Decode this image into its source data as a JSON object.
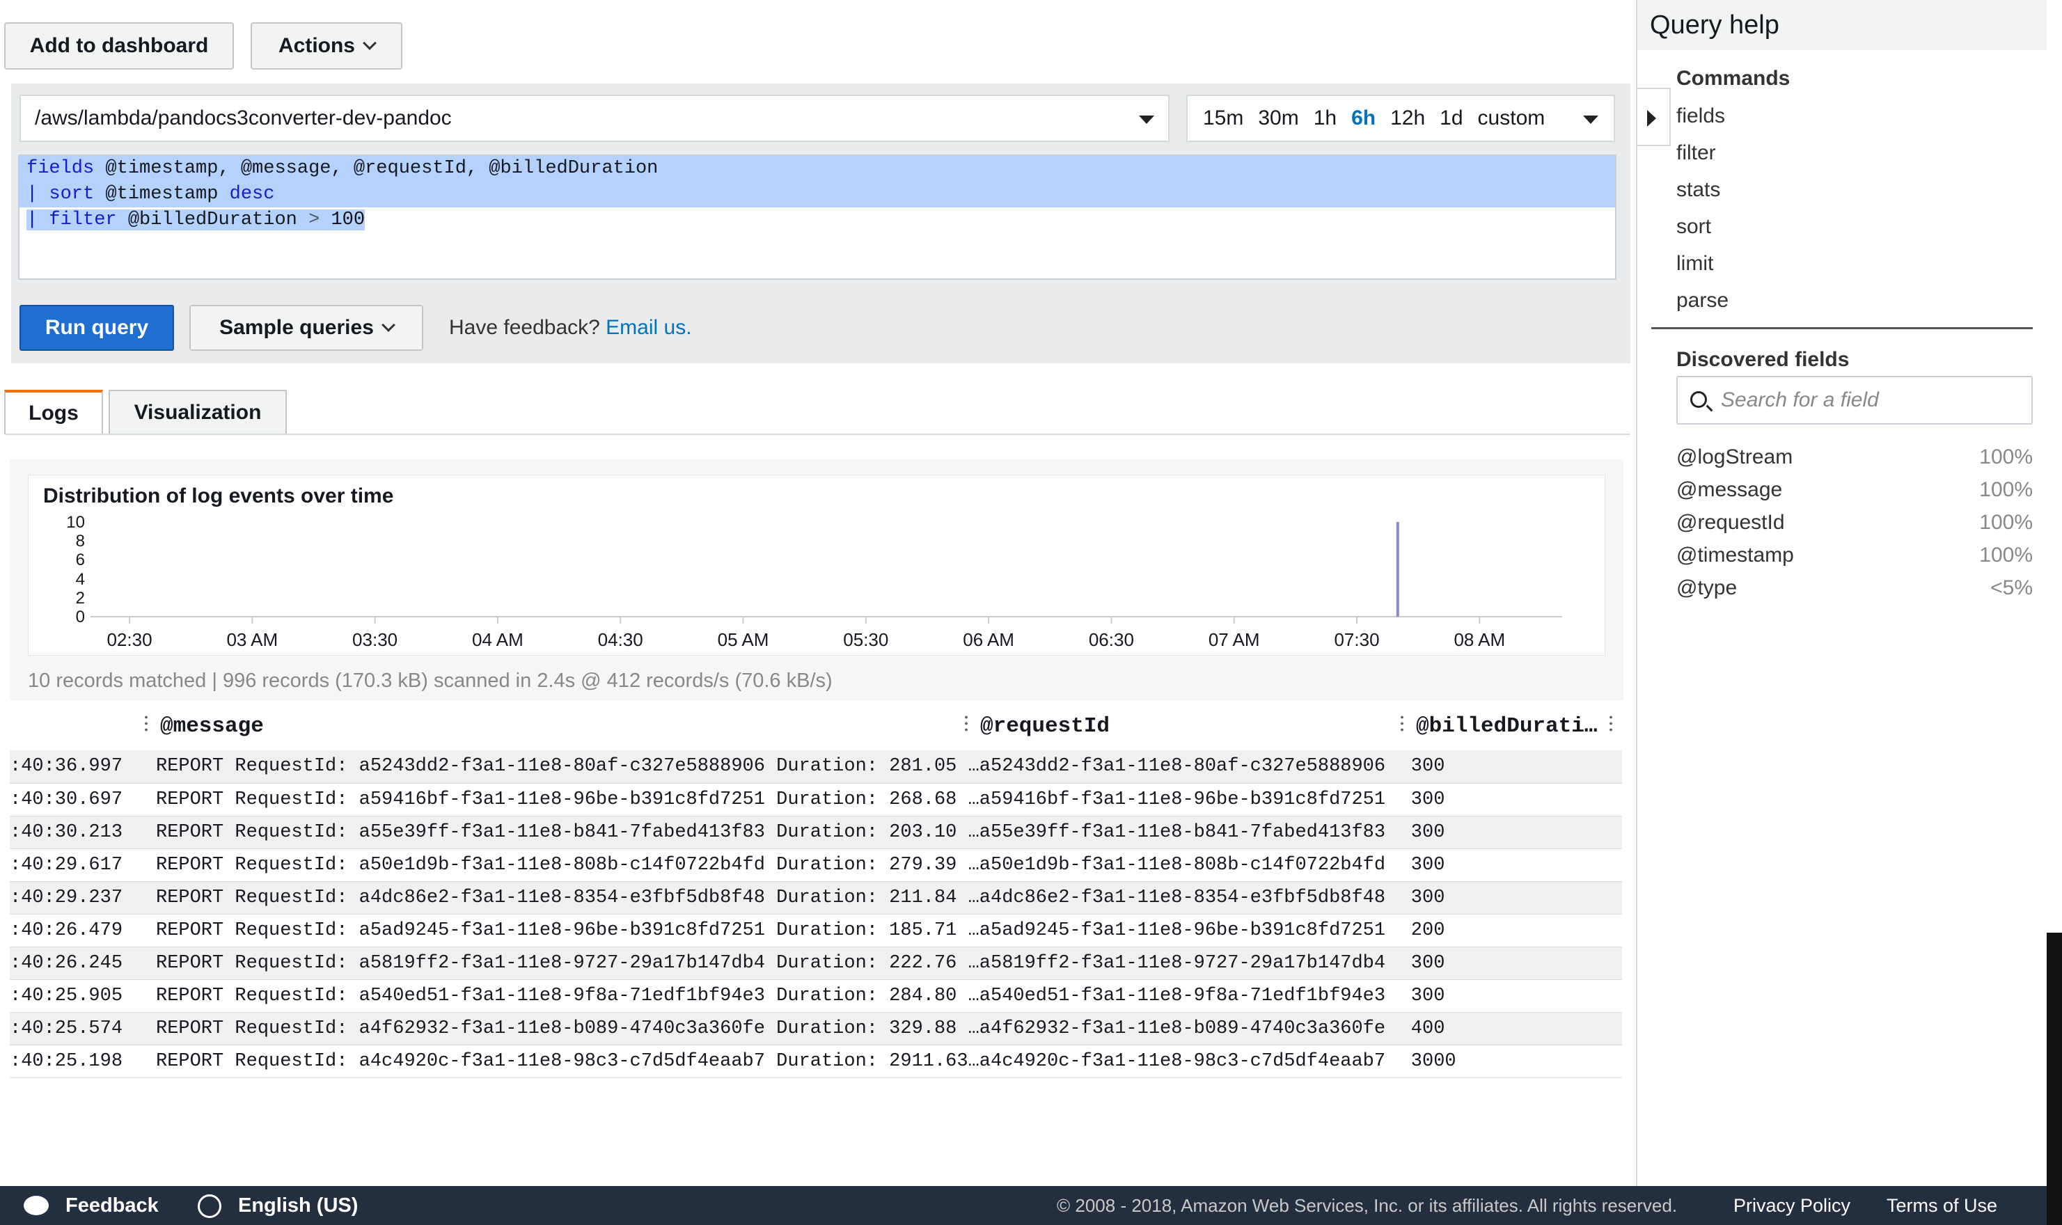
{
  "toolbar": {
    "add_label": "Add to dashboard",
    "actions_label": "Actions"
  },
  "loggroup": {
    "value": "/aws/lambda/pandocs3converter-dev-pandoc"
  },
  "time_range": {
    "options": [
      "15m",
      "30m",
      "1h",
      "6h",
      "12h",
      "1d",
      "custom"
    ],
    "selected": "6h"
  },
  "query": {
    "line1": {
      "kw": "fields",
      "rest": " @timestamp, @message, @requestId, @billedDuration"
    },
    "line2": {
      "pipe": "|",
      "kw": "sort",
      "rest": " @timestamp ",
      "kw2": "desc"
    },
    "line3": {
      "pipe": "|",
      "kw": "filter",
      "rest": " @billedDuration ",
      "op": ">",
      "num": " 100"
    }
  },
  "actions": {
    "run_label": "Run query",
    "samples_label": "Sample queries",
    "feedback_prefix": "Have feedback?",
    "feedback_link": "Email us."
  },
  "tabs": [
    {
      "label": "Logs",
      "active": true
    },
    {
      "label": "Visualization",
      "active": false
    }
  ],
  "chart_data": {
    "type": "bar",
    "title": "Distribution of log events over time",
    "yticks": [
      "10",
      "8",
      "6",
      "4",
      "2",
      "0"
    ],
    "ylim": [
      0,
      10
    ],
    "xticks": [
      "02:30",
      "03 AM",
      "03:30",
      "04 AM",
      "04:30",
      "05 AM",
      "05:30",
      "06 AM",
      "06:30",
      "07 AM",
      "07:30",
      "08 AM"
    ],
    "bars": [
      {
        "x": "07:40",
        "value": 10
      }
    ],
    "bar_color": "#8c8cc8"
  },
  "summary": "10 records matched | 996 records (170.3 kB) scanned in 2.4s @ 412 records/s (70.6 kB/s)",
  "table": {
    "columns": [
      "@message",
      "@requestId",
      "@billedDurati…"
    ],
    "rows": [
      {
        "ts": ":40:36.997",
        "msg": "REPORT RequestId: a5243dd2-f3a1-11e8-80af-c327e5888906 Duration: 281.05 …",
        "rid": "a5243dd2-f3a1-11e8-80af-c327e5888906",
        "bd": "300"
      },
      {
        "ts": ":40:30.697",
        "msg": "REPORT RequestId: a59416bf-f3a1-11e8-96be-b391c8fd7251 Duration: 268.68 …",
        "rid": "a59416bf-f3a1-11e8-96be-b391c8fd7251",
        "bd": "300"
      },
      {
        "ts": ":40:30.213",
        "msg": "REPORT RequestId: a55e39ff-f3a1-11e8-b841-7fabed413f83 Duration: 203.10 …",
        "rid": "a55e39ff-f3a1-11e8-b841-7fabed413f83",
        "bd": "300"
      },
      {
        "ts": ":40:29.617",
        "msg": "REPORT RequestId: a50e1d9b-f3a1-11e8-808b-c14f0722b4fd Duration: 279.39 …",
        "rid": "a50e1d9b-f3a1-11e8-808b-c14f0722b4fd",
        "bd": "300"
      },
      {
        "ts": ":40:29.237",
        "msg": "REPORT RequestId: a4dc86e2-f3a1-11e8-8354-e3fbf5db8f48 Duration: 211.84 …",
        "rid": "a4dc86e2-f3a1-11e8-8354-e3fbf5db8f48",
        "bd": "300"
      },
      {
        "ts": ":40:26.479",
        "msg": "REPORT RequestId: a5ad9245-f3a1-11e8-96be-b391c8fd7251 Duration: 185.71 …",
        "rid": "a5ad9245-f3a1-11e8-96be-b391c8fd7251",
        "bd": "200"
      },
      {
        "ts": ":40:26.245",
        "msg": "REPORT RequestId: a5819ff2-f3a1-11e8-9727-29a17b147db4 Duration: 222.76 …",
        "rid": "a5819ff2-f3a1-11e8-9727-29a17b147db4",
        "bd": "300"
      },
      {
        "ts": ":40:25.905",
        "msg": "REPORT RequestId: a540ed51-f3a1-11e8-9f8a-71edf1bf94e3 Duration: 284.80 …",
        "rid": "a540ed51-f3a1-11e8-9f8a-71edf1bf94e3",
        "bd": "300"
      },
      {
        "ts": ":40:25.574",
        "msg": "REPORT RequestId: a4f62932-f3a1-11e8-b089-4740c3a360fe Duration: 329.88 …",
        "rid": "a4f62932-f3a1-11e8-b089-4740c3a360fe",
        "bd": "400"
      },
      {
        "ts": ":40:25.198",
        "msg": "REPORT RequestId: a4c4920c-f3a1-11e8-98c3-c7d5df4eaab7 Duration: 2911.63…",
        "rid": "a4c4920c-f3a1-11e8-98c3-c7d5df4eaab7",
        "bd": "3000"
      }
    ]
  },
  "help": {
    "title": "Query help",
    "commands_title": "Commands",
    "commands": [
      "fields",
      "filter",
      "stats",
      "sort",
      "limit",
      "parse"
    ],
    "discovered_title": "Discovered fields",
    "search_placeholder": "Search for a field",
    "fields": [
      {
        "name": "@logStream",
        "pct": "100%"
      },
      {
        "name": "@message",
        "pct": "100%"
      },
      {
        "name": "@requestId",
        "pct": "100%"
      },
      {
        "name": "@timestamp",
        "pct": "100%"
      },
      {
        "name": "@type",
        "pct": "<5%"
      }
    ]
  },
  "footer": {
    "feedback": "Feedback",
    "language": "English (US)",
    "copyright": "© 2008 - 2018, Amazon Web Services, Inc. or its affiliates. All rights reserved.",
    "privacy": "Privacy Policy",
    "terms": "Terms of Use"
  },
  "colors": {
    "primary": "#1f6fd1",
    "link": "#0073bb",
    "tab_accent": "#ec7211",
    "footer_bg": "#232f3e",
    "selection": "#b4d2fd"
  }
}
